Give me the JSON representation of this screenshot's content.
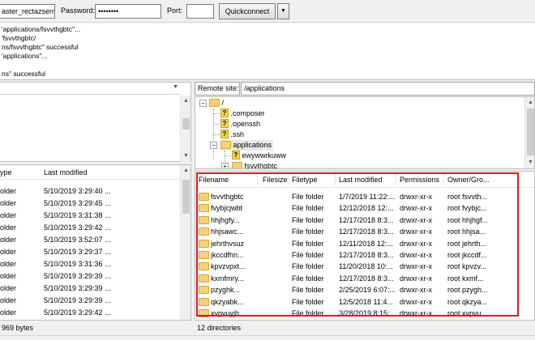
{
  "quickconnect": {
    "username_value": "aster_rectazserr",
    "password_label": "Password:",
    "password_value": "••••••••",
    "port_label": "Port:",
    "port_value": "",
    "button_label": "Quickconnect",
    "dropdown_glyph": "▼"
  },
  "message_log": [
    "'applications/fsvvthgbtc\"...",
    "'fsvvthgbtc/",
    "ns/fsvvthgbtc\" successful",
    "'applications\"...",
    "",
    "ns\" successful"
  ],
  "local": {
    "columns": {
      "type": "ype",
      "modified": "Last modified"
    },
    "rows": [
      {
        "type": "older",
        "modified": "5/10/2019 3:29:40 ..."
      },
      {
        "type": "older",
        "modified": "5/10/2019 3:29:45 ..."
      },
      {
        "type": "older",
        "modified": "5/10/2019 3:31:38 ..."
      },
      {
        "type": "older",
        "modified": "5/10/2019 3:29:42 ..."
      },
      {
        "type": "older",
        "modified": "5/10/2019 3:52:07 ..."
      },
      {
        "type": "older",
        "modified": "5/10/2019 3:29:37 ..."
      },
      {
        "type": "older",
        "modified": "5/10/2019 3:31:36 ..."
      },
      {
        "type": "older",
        "modified": "5/10/2019 3:29:39 ..."
      },
      {
        "type": "older",
        "modified": "5/10/2019 3:29:39 ..."
      },
      {
        "type": "older",
        "modified": "5/10/2019 3:29:39 ..."
      },
      {
        "type": "older",
        "modified": "5/10/2019 3:29:42 ..."
      }
    ],
    "status": "969 bytes"
  },
  "remote": {
    "site_label": "Remote site:",
    "site_path": "/applications",
    "tree": {
      "root": "/",
      "items": [
        ".composer",
        ".openssh",
        ".ssh"
      ],
      "current": "applications",
      "children": [
        "ewywwrkuww",
        "fsvvthgbtc"
      ]
    },
    "columns": {
      "filename": "Filename",
      "filesize": "Filesize",
      "filetype": "Filetype",
      "modified": "Last modified",
      "permissions": "Permissions",
      "owner": "Owner/Gro..."
    },
    "rows": [
      {
        "name": "fsvvthgbtc",
        "type": "File folder",
        "modified": "1/7/2019 11:22:...",
        "perm": "drwxr-xr-x",
        "owner": "root fsvvth..."
      },
      {
        "name": "fvybjcjwbt",
        "type": "File folder",
        "modified": "12/12/2018 12:...",
        "perm": "drwxr-xr-x",
        "owner": "root fvybjc..."
      },
      {
        "name": "hhjhgfy...",
        "type": "File folder",
        "modified": "12/17/2018 8:3...",
        "perm": "drwxr-xr-x",
        "owner": "root hhjhgf..."
      },
      {
        "name": "hhjsawc...",
        "type": "File folder",
        "modified": "12/17/2018 8:3...",
        "perm": "drwxr-xr-x",
        "owner": "root hhjsa..."
      },
      {
        "name": "jehrthvsuz",
        "type": "File folder",
        "modified": "12/11/2018 12:...",
        "perm": "drwxr-xr-x",
        "owner": "root jehrth..."
      },
      {
        "name": "jkccdfhn...",
        "type": "File folder",
        "modified": "12/17/2018 8:3...",
        "perm": "drwxr-xr-x",
        "owner": "root jkccdf..."
      },
      {
        "name": "kpvzvpxt...",
        "type": "File folder",
        "modified": "11/20/2018 10:...",
        "perm": "drwxr-xr-x",
        "owner": "root kpvzv..."
      },
      {
        "name": "kxmfmry...",
        "type": "File folder",
        "modified": "12/17/2018 8:3...",
        "perm": "drwxr-xr-x",
        "owner": "root kxmf..."
      },
      {
        "name": "pzyghk...",
        "type": "File folder",
        "modified": "2/25/2019 6:07:...",
        "perm": "drwxr-xr-x",
        "owner": "root pzygh..."
      },
      {
        "name": "qkzyabk...",
        "type": "File folder",
        "modified": "12/5/2018 11:4...",
        "perm": "drwxr-xr-x",
        "owner": "root qkzya..."
      },
      {
        "name": "xvpvuyjh...",
        "type": "File folder",
        "modified": "3/28/2019 8:15:...",
        "perm": "drwxr-xr-x",
        "owner": "root xvpvu..."
      }
    ],
    "status": "12 directories"
  },
  "colors": {
    "highlight": "#e0181d",
    "folder": "#f6d27a",
    "background": "#f0f0f0"
  }
}
